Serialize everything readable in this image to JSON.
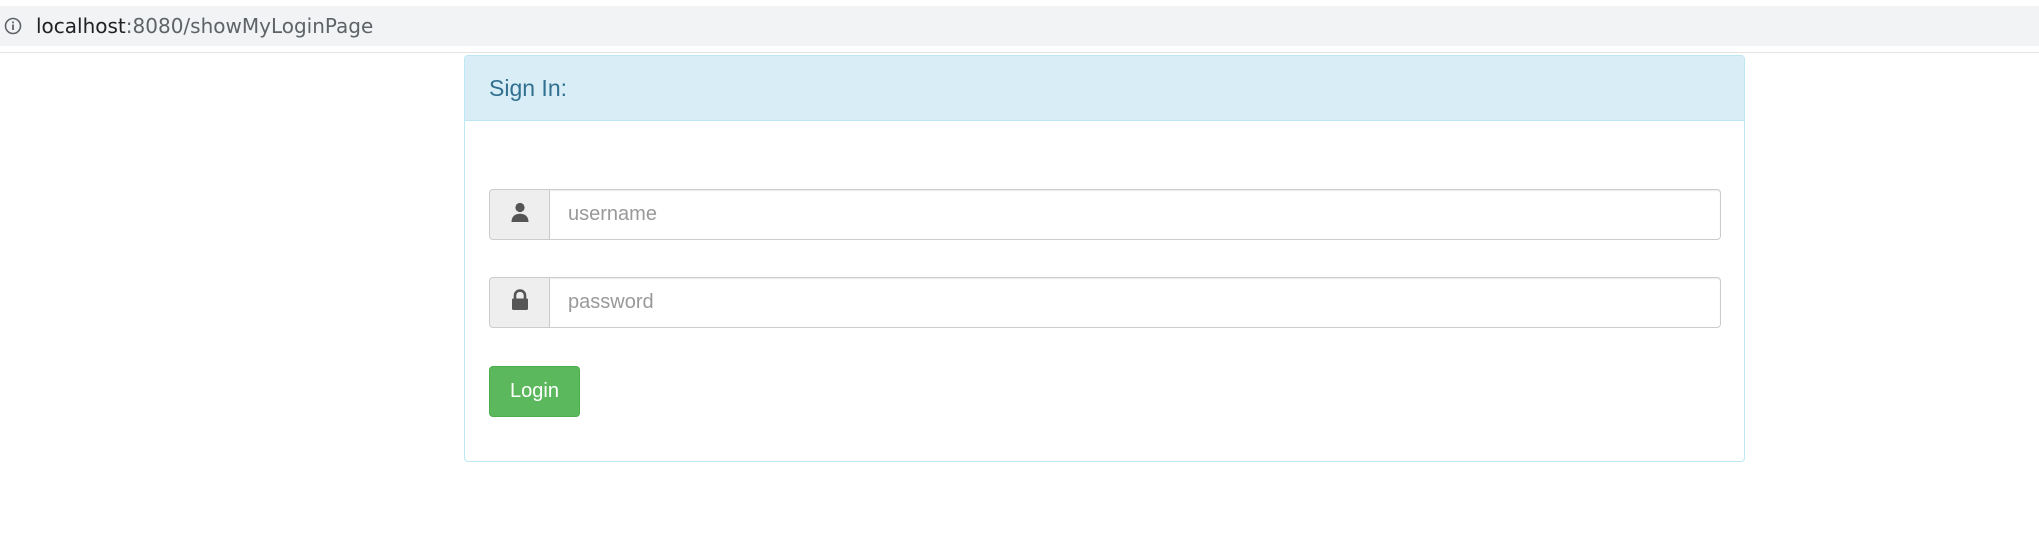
{
  "browser": {
    "url_host": "localhost",
    "url_path": ":8080/showMyLoginPage",
    "info_icon": "info-circle-icon"
  },
  "panel": {
    "title": "Sign In:"
  },
  "form": {
    "username": {
      "icon": "user-icon",
      "placeholder": "username",
      "value": ""
    },
    "password": {
      "icon": "lock-icon",
      "placeholder": "password",
      "value": ""
    },
    "login_label": "Login"
  },
  "colors": {
    "panel_heading_bg": "#d9edf7",
    "panel_title": "#31708f",
    "panel_border": "#bce8f1",
    "login_button": "#5cb85c"
  }
}
